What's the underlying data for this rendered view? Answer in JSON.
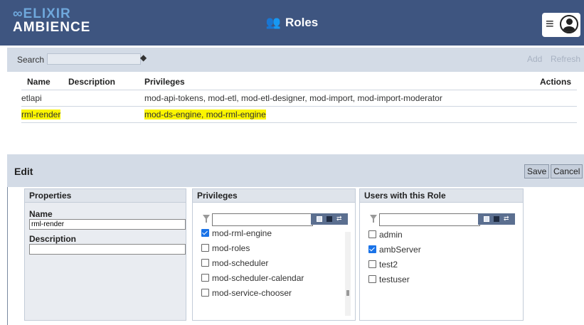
{
  "header": {
    "logo_line1": "ELIXIR",
    "logo_line2": "AMBIENCE",
    "title": "Roles",
    "menu_glyph": "≡"
  },
  "search": {
    "label": "Search",
    "value": "",
    "add_label": "Add",
    "refresh_label": "Refresh"
  },
  "roles_table": {
    "columns": [
      "Name",
      "Description",
      "Privileges",
      "Actions"
    ],
    "rows": [
      {
        "name": "etlapi",
        "description": "",
        "privileges": "mod-api-tokens, mod-etl, mod-etl-designer, mod-import, mod-import-moderator"
      },
      {
        "name": "rml-render",
        "description": "",
        "privileges": "mod-ds-engine, mod-rml-engine"
      }
    ]
  },
  "edit": {
    "label": "Edit",
    "save_label": "Save",
    "cancel_label": "Cancel",
    "properties": {
      "header": "Properties",
      "name_label": "Name",
      "name_value": "rml-render",
      "description_label": "Description",
      "description_value": ""
    },
    "privileges": {
      "header": "Privileges",
      "items": [
        {
          "label": "mod-rml-engine",
          "checked": true
        },
        {
          "label": "mod-roles",
          "checked": false
        },
        {
          "label": "mod-scheduler",
          "checked": false
        },
        {
          "label": "mod-scheduler-calendar",
          "checked": false
        },
        {
          "label": "mod-service-chooser",
          "checked": false
        }
      ]
    },
    "users": {
      "header": "Users with this Role",
      "items": [
        {
          "label": "admin",
          "checked": false
        },
        {
          "label": "ambServer",
          "checked": true
        },
        {
          "label": "test2",
          "checked": false
        },
        {
          "label": "testuser",
          "checked": false
        }
      ]
    }
  },
  "colors": {
    "topbar": "#3e5580",
    "highlight": "#fbf500",
    "panel_bar": "#d3dbe6"
  }
}
